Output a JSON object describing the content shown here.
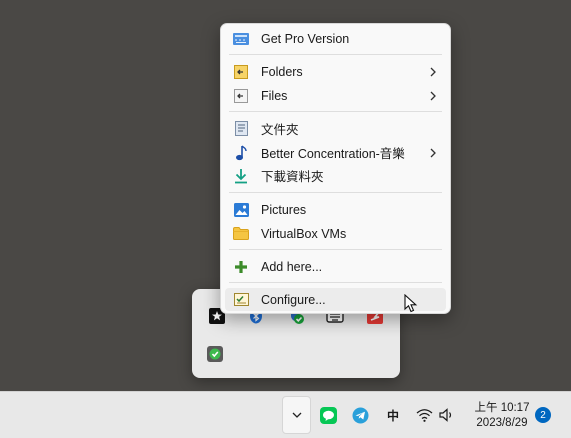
{
  "menu": {
    "items": [
      {
        "label": "Get Pro Version",
        "icon": "pro-version-icon"
      },
      {
        "label": "Folders",
        "icon": "folders-icon",
        "submenu": true
      },
      {
        "label": "Files",
        "icon": "files-icon",
        "submenu": true
      },
      {
        "label": "文件夾",
        "icon": "document-folder-icon"
      },
      {
        "label": "Better Concentration-音樂",
        "icon": "music-note-icon",
        "submenu": true
      },
      {
        "label": "下載資料夾",
        "icon": "download-icon"
      },
      {
        "label": "Pictures",
        "icon": "pictures-icon"
      },
      {
        "label": "VirtualBox VMs",
        "icon": "folder-icon"
      },
      {
        "label": "Add here...",
        "icon": "plus-icon"
      },
      {
        "label": "Configure...",
        "icon": "configure-icon",
        "hovered": true
      }
    ]
  },
  "tray_flyout": {
    "icons": [
      "star-app-icon",
      "bluetooth-icon",
      "shield-check-icon",
      "keyboard-icon",
      "red-app-icon",
      "green-check-app-icon"
    ]
  },
  "taskbar": {
    "chevron_icon": "chevron-down-icon",
    "tray_icons": [
      "line-chat-icon",
      "telegram-icon",
      "ime-icon",
      "wifi-icon",
      "speaker-icon"
    ],
    "ime_label": "中",
    "clock_time": "上午 10:17",
    "clock_date": "2023/8/29",
    "notification_count": "2"
  },
  "colors": {
    "desktop": "#4a4845",
    "menu_bg": "#f9f9f9",
    "accent": "#0067c0",
    "taskbar": "#e8e8e8"
  }
}
